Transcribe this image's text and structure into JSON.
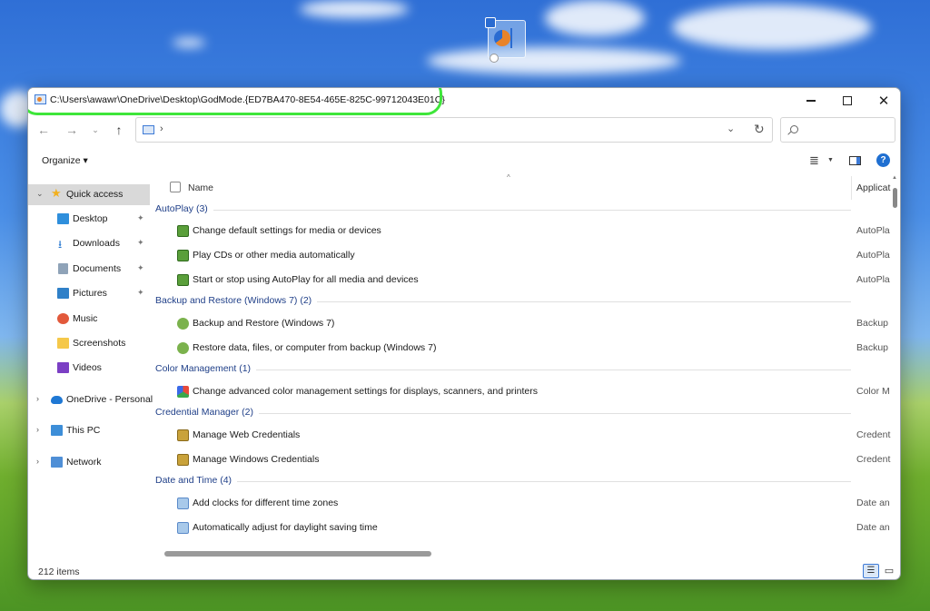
{
  "window": {
    "title": "C:\\Users\\awawr\\OneDrive\\Desktop\\GodMode.{ED7BA470-8E54-465E-825C-99712043E01C}"
  },
  "titlebar": {
    "minimize_icon": "minimize-icon",
    "maximize_icon": "maximize-icon",
    "close_glyph": "✕"
  },
  "nav": {
    "back_glyph": "←",
    "forward_glyph": "→",
    "recent_glyph": "⌄",
    "up_glyph": "↑",
    "address_chevron": "›",
    "address_dropdown_glyph": "⌄",
    "refresh_glyph": "↻"
  },
  "toolbar": {
    "organize_label": "Organize ▾",
    "view_glyph": "≣",
    "view_dropdown_glyph": "▼",
    "help_label": "?"
  },
  "sidebar": {
    "items": [
      {
        "label": "Quick access",
        "icon": "star-icon",
        "expanded": true,
        "selected": true
      },
      {
        "label": "Desktop",
        "icon": "desktop-icon",
        "pinned": true
      },
      {
        "label": "Downloads",
        "icon": "download-icon",
        "pinned": true
      },
      {
        "label": "Documents",
        "icon": "documents-icon",
        "pinned": true
      },
      {
        "label": "Pictures",
        "icon": "pictures-icon",
        "pinned": true
      },
      {
        "label": "Music",
        "icon": "music-icon"
      },
      {
        "label": "Screenshots",
        "icon": "folder-icon"
      },
      {
        "label": "Videos",
        "icon": "videos-icon"
      },
      {
        "label": "OneDrive - Personal",
        "icon": "onedrive-cloud-icon"
      },
      {
        "label": "This PC",
        "icon": "computer-icon"
      },
      {
        "label": "Network",
        "icon": "network-icon"
      }
    ],
    "pin_glyph": "📌",
    "expanded_chevron": "⌄",
    "collapsed_chevron": "›"
  },
  "list": {
    "columns": {
      "name": "Name",
      "application": "Applicat"
    },
    "sort_glyph": "^",
    "groups": [
      {
        "title": "AutoPlay (3)",
        "items": [
          {
            "name": "Change default settings for media or devices",
            "app": "AutoPla"
          },
          {
            "name": "Play CDs or other media automatically",
            "app": "AutoPla"
          },
          {
            "name": "Start or stop using AutoPlay for all media and devices",
            "app": "AutoPla"
          }
        ]
      },
      {
        "title": "Backup and Restore (Windows 7) (2)",
        "items": [
          {
            "name": "Backup and Restore (Windows 7)",
            "app": "Backup"
          },
          {
            "name": "Restore data, files, or computer from backup (Windows 7)",
            "app": "Backup"
          }
        ]
      },
      {
        "title": "Color Management (1)",
        "items": [
          {
            "name": "Change advanced color management settings for displays, scanners, and printers",
            "app": "Color M"
          }
        ]
      },
      {
        "title": "Credential Manager (2)",
        "items": [
          {
            "name": "Manage Web Credentials",
            "app": "Credent"
          },
          {
            "name": "Manage Windows Credentials",
            "app": "Credent"
          }
        ]
      },
      {
        "title": "Date and Time (4)",
        "items": [
          {
            "name": "Add clocks for different time zones",
            "app": "Date an"
          },
          {
            "name": "Automatically adjust for daylight saving time",
            "app": "Date an"
          }
        ]
      }
    ]
  },
  "status": {
    "item_count": "212 items",
    "details_view_glyph": "☰",
    "tiles_view_glyph": "▭"
  },
  "colors": {
    "highlight_ring": "#3ee63a",
    "group_title": "#1f3f88",
    "accent": "#1f6fd1"
  }
}
